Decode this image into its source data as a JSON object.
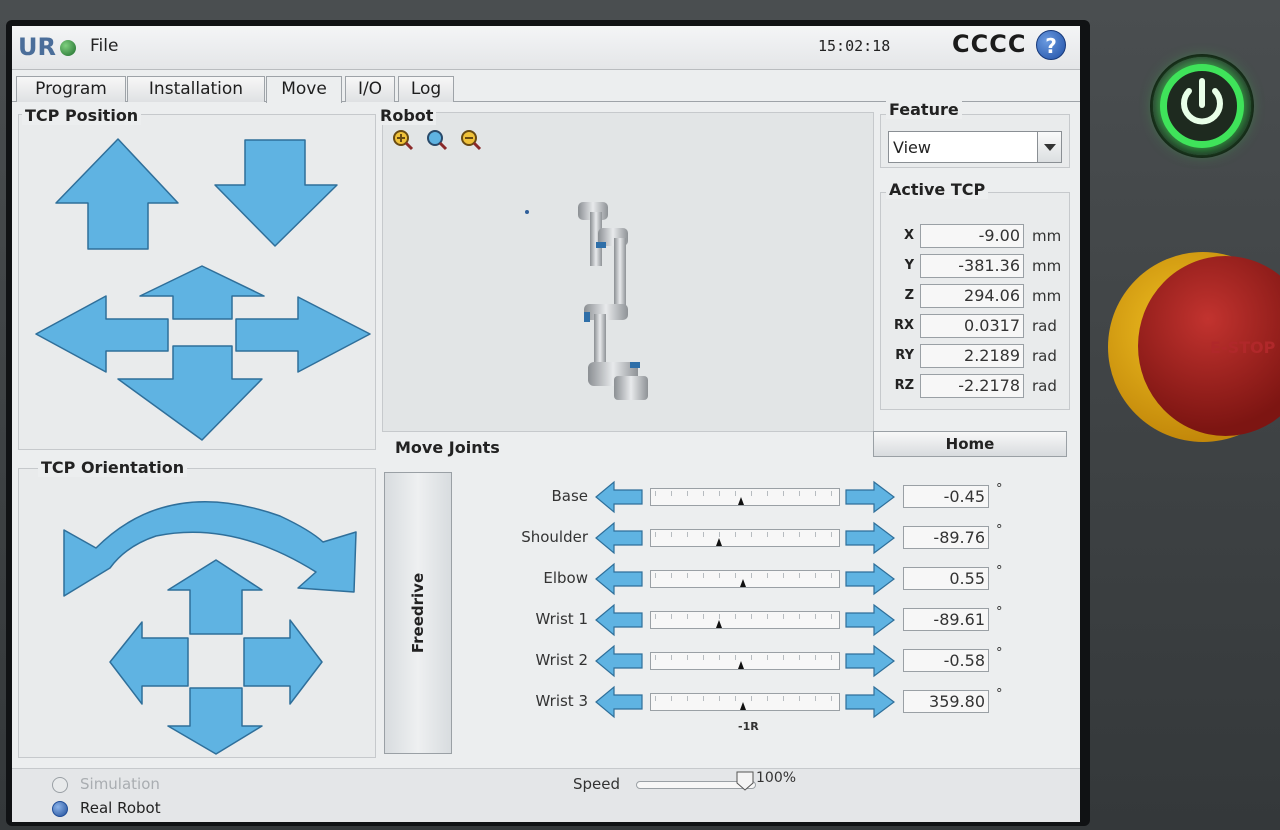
{
  "titlebar": {
    "logo": "UR",
    "file_menu": "File",
    "time": "15:02:18",
    "robot_name": "CCCC",
    "help": "?"
  },
  "tabs": [
    {
      "label": "Program",
      "active": false
    },
    {
      "label": "Installation",
      "active": false
    },
    {
      "label": "Move",
      "active": true
    },
    {
      "label": "I/O",
      "active": false
    },
    {
      "label": "Log",
      "active": false
    }
  ],
  "tcp_position": {
    "title": "TCP Position"
  },
  "tcp_orientation": {
    "title": "TCP Orientation"
  },
  "robot_view": {
    "title": "Robot"
  },
  "feature": {
    "title": "Feature",
    "selected": "View"
  },
  "active_tcp": {
    "title": "Active TCP",
    "rows": [
      {
        "label": "X",
        "value": "-9.00",
        "unit": "mm"
      },
      {
        "label": "Y",
        "value": "-381.36",
        "unit": "mm"
      },
      {
        "label": "Z",
        "value": "294.06",
        "unit": "mm"
      },
      {
        "label": "RX",
        "value": "0.0317",
        "unit": "rad"
      },
      {
        "label": "RY",
        "value": "2.2189",
        "unit": "rad"
      },
      {
        "label": "RZ",
        "value": "-2.2178",
        "unit": "rad"
      }
    ]
  },
  "home_button": "Home",
  "move_joints": {
    "title": "Move Joints",
    "freedrive": "Freedrive",
    "rotation_label": "-1R",
    "joints": [
      {
        "name": "Base",
        "value": "-0.45",
        "unit": "°",
        "position": 0.49
      },
      {
        "name": "Shoulder",
        "value": "-89.76",
        "unit": "°",
        "position": 0.37
      },
      {
        "name": "Elbow",
        "value": "0.55",
        "unit": "°",
        "position": 0.5
      },
      {
        "name": "Wrist 1",
        "value": "-89.61",
        "unit": "°",
        "position": 0.37
      },
      {
        "name": "Wrist 2",
        "value": "-0.58",
        "unit": "°",
        "position": 0.49
      },
      {
        "name": "Wrist 3",
        "value": "359.80",
        "unit": "°",
        "position": 0.5
      }
    ]
  },
  "bottom": {
    "simulation": "Simulation",
    "real_robot": "Real Robot",
    "speed_label": "Speed",
    "speed_value": "100%"
  },
  "hardware": {
    "estop_label": "E-STOP"
  },
  "colors": {
    "arrow_fill": "#5fb3e2",
    "arrow_stroke": "#2f6f9a",
    "power_led": "#3fe35a",
    "estop_red": "#b0282a"
  }
}
